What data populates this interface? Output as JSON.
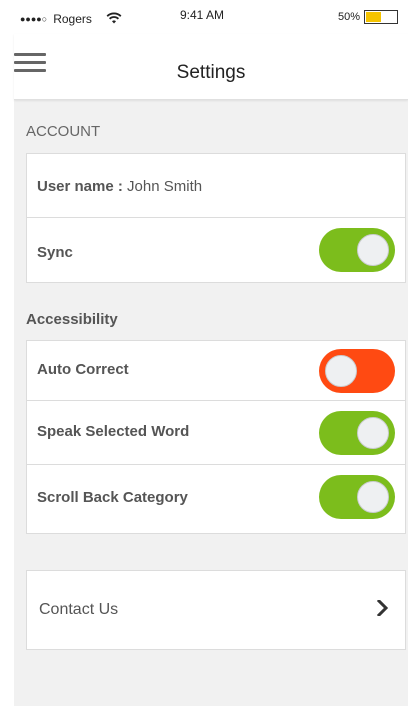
{
  "status_bar": {
    "signal_dots": "●●●●○",
    "carrier": "Rogers",
    "wifi_icon": "wifi-icon",
    "time": "9:41 AM",
    "battery_percent": "50%",
    "battery_level": 0.5,
    "battery_color": "#f5c400"
  },
  "header": {
    "menu_icon": "hamburger-menu-icon",
    "title": "Settings"
  },
  "account": {
    "section_label": "ACCOUNT",
    "username_label": "User name :",
    "username_value": "John Smith",
    "sync_label": "Sync",
    "sync_on": true
  },
  "accessibility": {
    "section_label": "Accessibility",
    "items": [
      {
        "label": "Auto Correct",
        "on": false
      },
      {
        "label": "Speak Selected Word",
        "on": true
      },
      {
        "label": "Scroll Back Category",
        "on": true
      }
    ]
  },
  "contact": {
    "label": "Contact Us",
    "chevron_icon": "chevron-right-icon"
  },
  "colors": {
    "toggle_on": "#7cbd1c",
    "toggle_off": "#ff4a12",
    "background": "#f1f1f1"
  }
}
